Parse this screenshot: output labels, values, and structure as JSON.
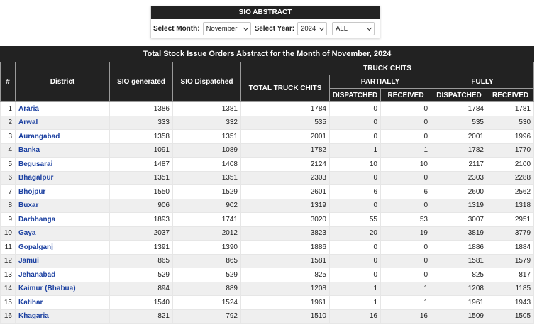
{
  "filters": {
    "title": "SIO ABSTRACT",
    "month_label": "Select Month:",
    "month_value": "November",
    "year_label": "Select Year:",
    "year_value": "2024",
    "scope_value": "ALL"
  },
  "table": {
    "caption": "Total Stock Issue Orders Abstract for the Month of November, 2024",
    "headers": {
      "index": "#",
      "district": "District",
      "sio_generated": "SIO generated",
      "sio_dispatched": "SIO Dispatched",
      "truck_chits": "TRUCK CHITS",
      "total_truck_chits": "TOTAL TRUCK CHITS",
      "partially": "PARTIALLY",
      "fully": "FULLY",
      "dispatched": "DISPATCHED",
      "received": "RECEIVED"
    },
    "rows": [
      [
        "1",
        "Araria",
        "1386",
        "1381",
        "1784",
        "0",
        "0",
        "1784",
        "1781"
      ],
      [
        "2",
        "Arwal",
        "333",
        "332",
        "535",
        "0",
        "0",
        "535",
        "530"
      ],
      [
        "3",
        "Aurangabad",
        "1358",
        "1351",
        "2001",
        "0",
        "0",
        "2001",
        "1996"
      ],
      [
        "4",
        "Banka",
        "1091",
        "1089",
        "1782",
        "1",
        "1",
        "1782",
        "1770"
      ],
      [
        "5",
        "Begusarai",
        "1487",
        "1408",
        "2124",
        "10",
        "10",
        "2117",
        "2100"
      ],
      [
        "6",
        "Bhagalpur",
        "1351",
        "1351",
        "2303",
        "0",
        "0",
        "2303",
        "2288"
      ],
      [
        "7",
        "Bhojpur",
        "1550",
        "1529",
        "2601",
        "6",
        "6",
        "2600",
        "2562"
      ],
      [
        "8",
        "Buxar",
        "906",
        "902",
        "1319",
        "0",
        "0",
        "1319",
        "1318"
      ],
      [
        "9",
        "Darbhanga",
        "1893",
        "1741",
        "3020",
        "55",
        "53",
        "3007",
        "2951"
      ],
      [
        "10",
        "Gaya",
        "2037",
        "2012",
        "3823",
        "20",
        "19",
        "3819",
        "3779"
      ],
      [
        "11",
        "Gopalganj",
        "1391",
        "1390",
        "1886",
        "0",
        "0",
        "1886",
        "1884"
      ],
      [
        "12",
        "Jamui",
        "865",
        "865",
        "1581",
        "0",
        "0",
        "1581",
        "1579"
      ],
      [
        "13",
        "Jehanabad",
        "529",
        "529",
        "825",
        "0",
        "0",
        "825",
        "817"
      ],
      [
        "14",
        "Kaimur (Bhabua)",
        "894",
        "889",
        "1208",
        "1",
        "1",
        "1208",
        "1185"
      ],
      [
        "15",
        "Katihar",
        "1540",
        "1524",
        "1961",
        "1",
        "1",
        "1961",
        "1943"
      ],
      [
        "16",
        "Khagaria",
        "821",
        "792",
        "1510",
        "16",
        "16",
        "1509",
        "1505"
      ]
    ]
  }
}
